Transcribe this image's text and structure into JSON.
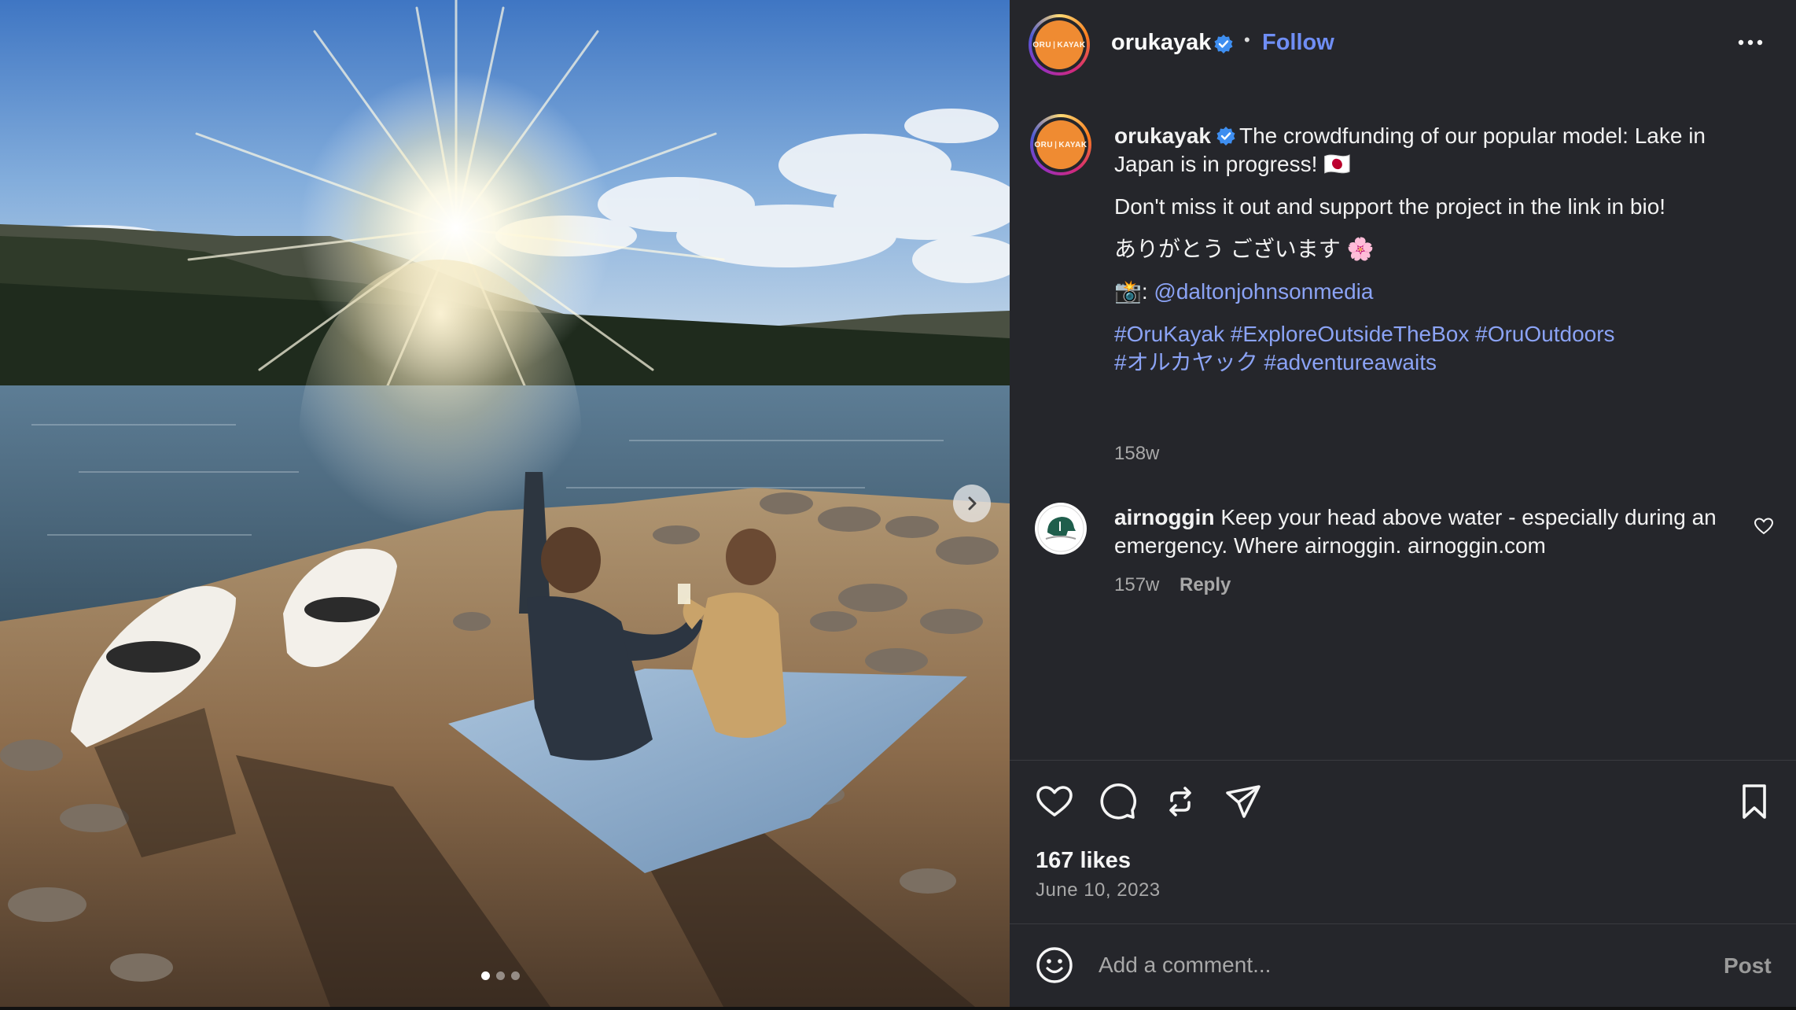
{
  "post": {
    "media": {
      "alt": "",
      "carousel_dots": 3,
      "active_dot": 0,
      "next_icon": "chevron-right-icon"
    },
    "header": {
      "username": "orukayak",
      "avatar_text": "ORU|KAYAK",
      "verified": true,
      "separator": "•",
      "follow_label": "Follow",
      "more_icon": "more-horizontal-icon"
    },
    "caption": {
      "username": "orukayak",
      "line1": "The crowdfunding of our popular model: Lake in Japan is in progress! 🇯🇵",
      "line2": "Don't miss it out and support the project in the link in bio!",
      "line3": "ありがとう ございます 🌸",
      "camera_prefix": "📸: ",
      "mention": "@daltonjohnsonmedia",
      "hashtags_line1": "#OruKayak #ExploreOutsideTheBox #OruOutdoors",
      "hashtags_line2": "#オルカヤック #adventureawaits",
      "time": "158w"
    },
    "comments": [
      {
        "username": "airnoggin",
        "text": "Keep your head above water - especially during an emergency. Where airnoggin. airnoggin.com",
        "time": "157w",
        "reply_label": "Reply"
      }
    ],
    "actions": {
      "like_icon": "heart-icon",
      "comment_icon": "comment-bubble-icon",
      "share_icon": "repost-icon",
      "send_icon": "send-icon",
      "save_icon": "bookmark-icon"
    },
    "likes": "167 likes",
    "date": "June 10, 2023",
    "composer": {
      "emoji_icon": "smiley-icon",
      "placeholder": "Add a comment...",
      "post_label": "Post"
    }
  },
  "colors": {
    "panel_bg": "#25262b",
    "link": "#6f8ef5",
    "muted_text": "#a8a8a8",
    "brand_orange": "#ef8b32"
  }
}
